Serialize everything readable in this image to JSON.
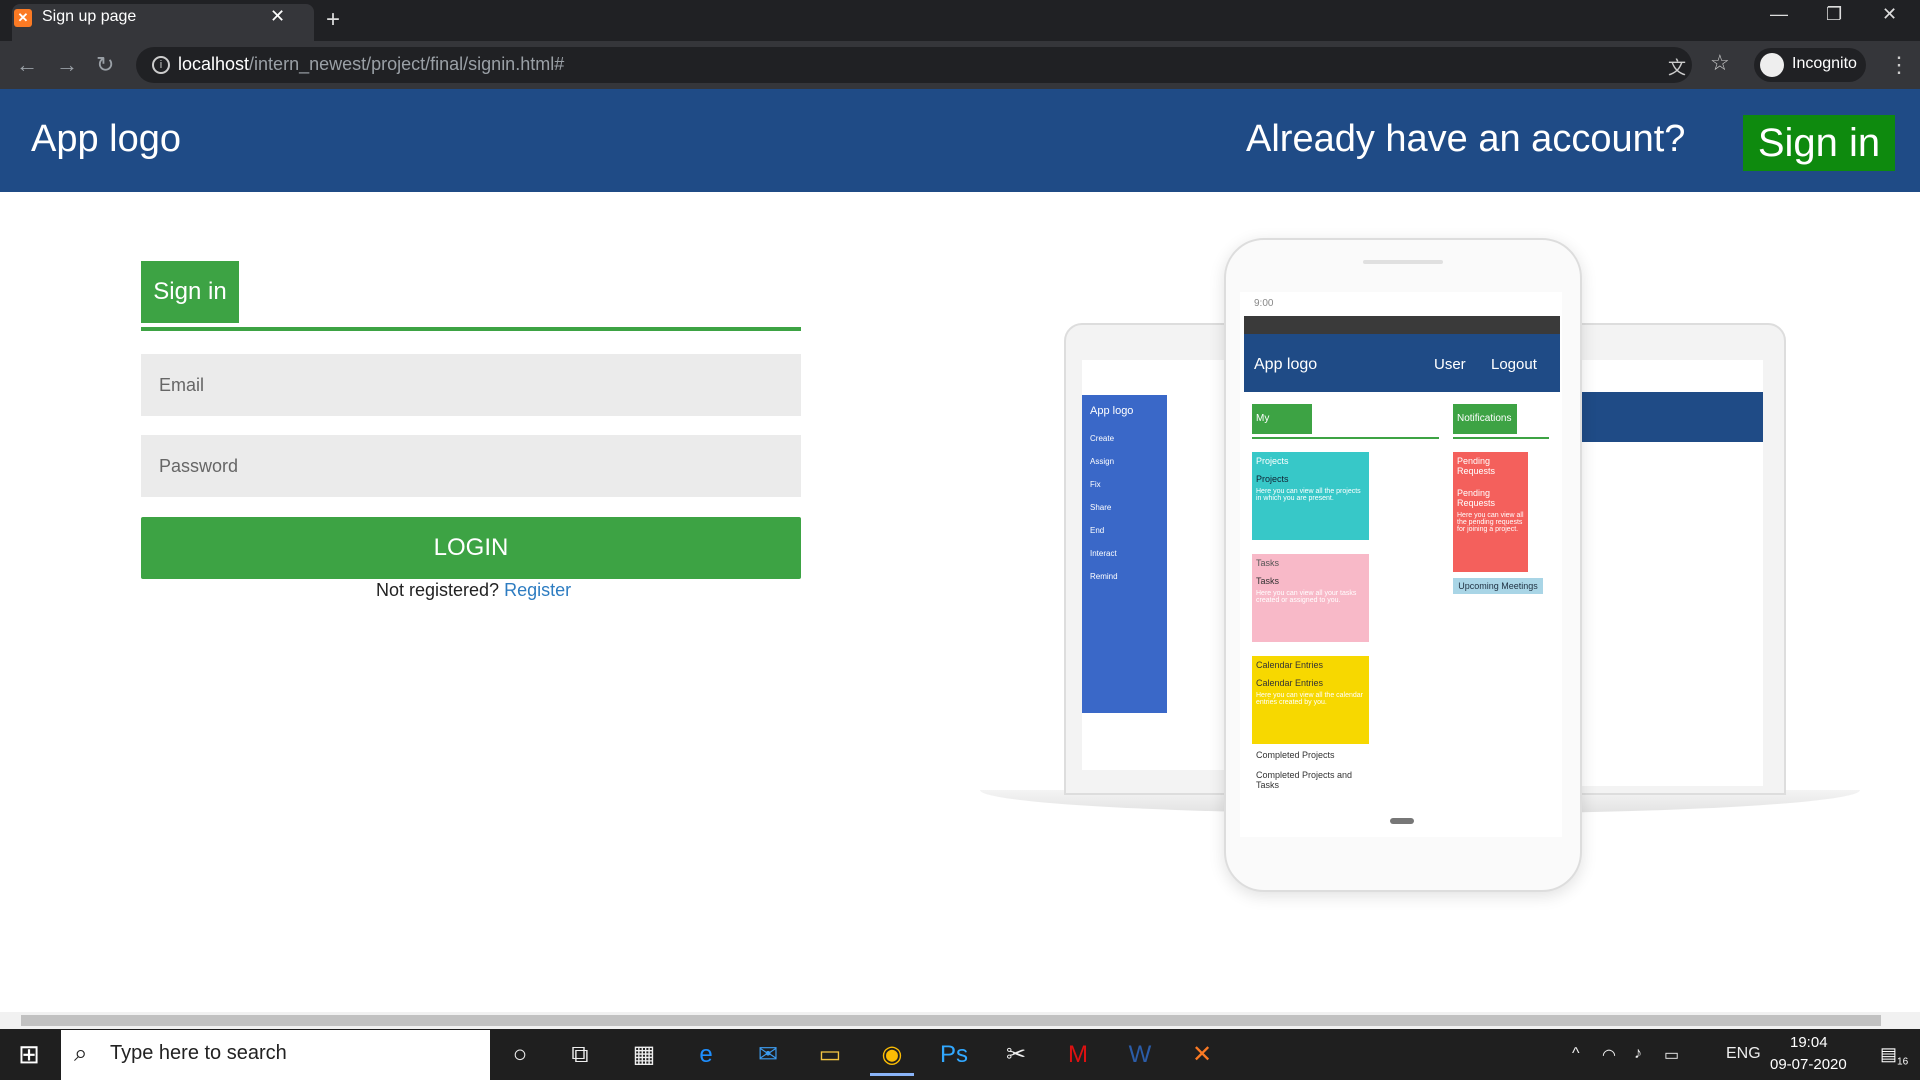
{
  "browser": {
    "tab_title": "Sign up page",
    "url_host": "localhost",
    "url_path": "/intern_newest/project/final/signin.html#",
    "profile_label": "Incognito"
  },
  "header": {
    "logo": "App logo",
    "prompt": "Already have an account?",
    "signin_button": "Sign in"
  },
  "form": {
    "tab_label": "Sign in",
    "email_placeholder": "Email",
    "password_placeholder": "Password",
    "login_button": "LOGIN",
    "not_registered": "Not registered?",
    "register_link": "Register"
  },
  "illustration": {
    "phone_time": "9:00",
    "app_logo": "App logo",
    "user": "User",
    "logout": "Logout",
    "dashboard_tab": "My Dashboard",
    "notifications_tab": "Notifications",
    "projects_header": "Projects",
    "projects_title": "Projects",
    "projects_text": "Here you can view all the projects in which you are present.",
    "tasks_header": "Tasks",
    "tasks_title": "Tasks",
    "tasks_text": "Here you can view all your tasks created or assigned to you.",
    "calendar_header": "Calendar Entries",
    "calendar_title": "Calendar Entries",
    "calendar_text": "Here you can view all the calendar entries created by you.",
    "completed_header": "Completed Projects",
    "completed_title": "Completed Projects and Tasks",
    "pending_header": "Pending Requests",
    "pending_title": "Pending Requests",
    "pending_text": "Here you can view all the pending requests for joining a project.",
    "meetings": "Upcoming Meetings",
    "sidebar_items": [
      "Create",
      "Assign",
      "Fix",
      "Share",
      "End",
      "Interact",
      "Remind"
    ]
  },
  "taskbar": {
    "search_placeholder": "Type here to search",
    "language": "ENG",
    "time": "19:04",
    "date": "09-07-2020",
    "notification_count": "16"
  },
  "colors": {
    "header_bg": "#1f4b86",
    "accent_green": "#3da344",
    "signin_green": "#0e8a0e",
    "link_blue": "#2d7cc1"
  }
}
